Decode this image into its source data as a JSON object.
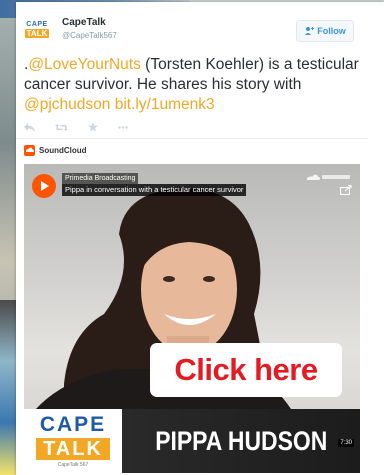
{
  "tweet": {
    "account_name": "CapeTalk",
    "account_handle": "@CapeTalk567",
    "avatar_line1": "CAPE",
    "avatar_line2": "TALK",
    "follow_label": "Follow",
    "text_prefix": ".",
    "mention_1": "@LoveYourNuts",
    "text_middle": " (Torsten Koehler) is a testicular cancer survivor. He shares his story with ",
    "mention_2": "@pjchudson",
    "text_space": " ",
    "link": "bit.ly/1umenk3",
    "actions": [
      "reply-icon",
      "retweet-icon",
      "favorite-icon",
      "more-icon"
    ]
  },
  "embed": {
    "provider_label": "SoundCloud",
    "track_artist": "Primedia Broadcasting",
    "track_title": "Pippa in conversation with a testicular cancer survivor",
    "overlay_button": "Click here",
    "logo_cape": "CAPE",
    "logo_talk": "TALK",
    "logo_sub": "CapeTalk 567",
    "presenter_name": "PIPPA HUDSON",
    "duration": "7:30"
  },
  "colors": {
    "link": "#f2a825",
    "soundcloud": "#ff5500",
    "click_here_text": "#e31b23",
    "brand_blue": "#1f5aa6"
  }
}
